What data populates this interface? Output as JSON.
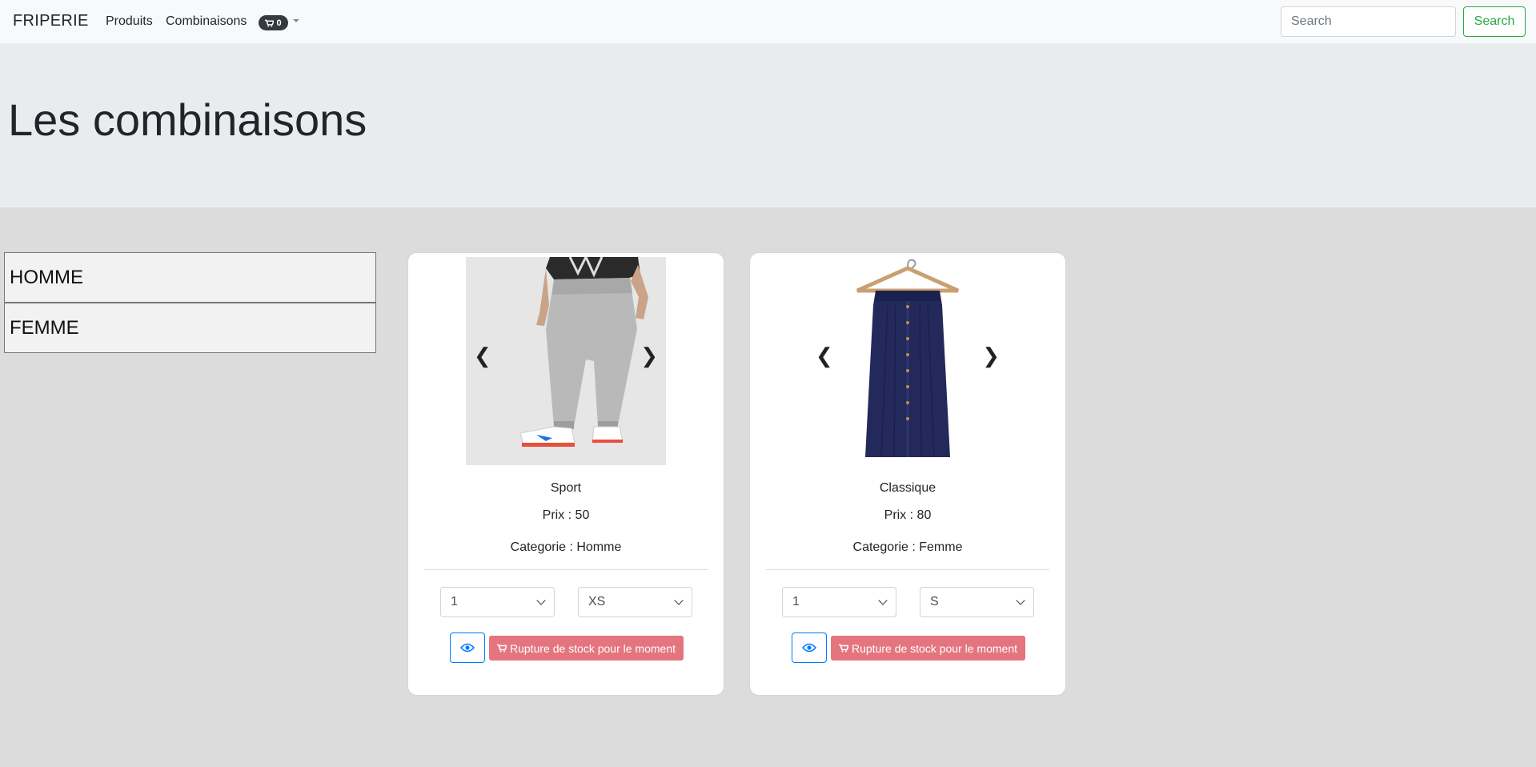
{
  "navbar": {
    "brand": "FRIPERIE",
    "links": [
      "Produits",
      "Combinaisons"
    ],
    "cart_count": "0",
    "search_placeholder": "Search",
    "search_button": "Search"
  },
  "jumbotron": {
    "title": "Les combinaisons"
  },
  "categories": [
    "HOMME",
    "FEMME"
  ],
  "products": [
    {
      "name": "Sport",
      "prix": "Prix : 50",
      "categorie": "Categorie : Homme",
      "quantity": "1",
      "size": "XS",
      "stock_label": "Rupture de stock pour le moment",
      "image": "grey-jogger-pants"
    },
    {
      "name": "Classique",
      "prix": "Prix : 80",
      "categorie": "Categorie : Femme",
      "quantity": "1",
      "size": "S",
      "stock_label": "Rupture de stock pour le moment",
      "image": "navy-skirt-on-hanger"
    }
  ],
  "icons": {
    "prev": "❮",
    "next": "❯"
  },
  "colors": {
    "success": "#28a745",
    "primary": "#007bff",
    "danger_light": "#e4757e"
  }
}
